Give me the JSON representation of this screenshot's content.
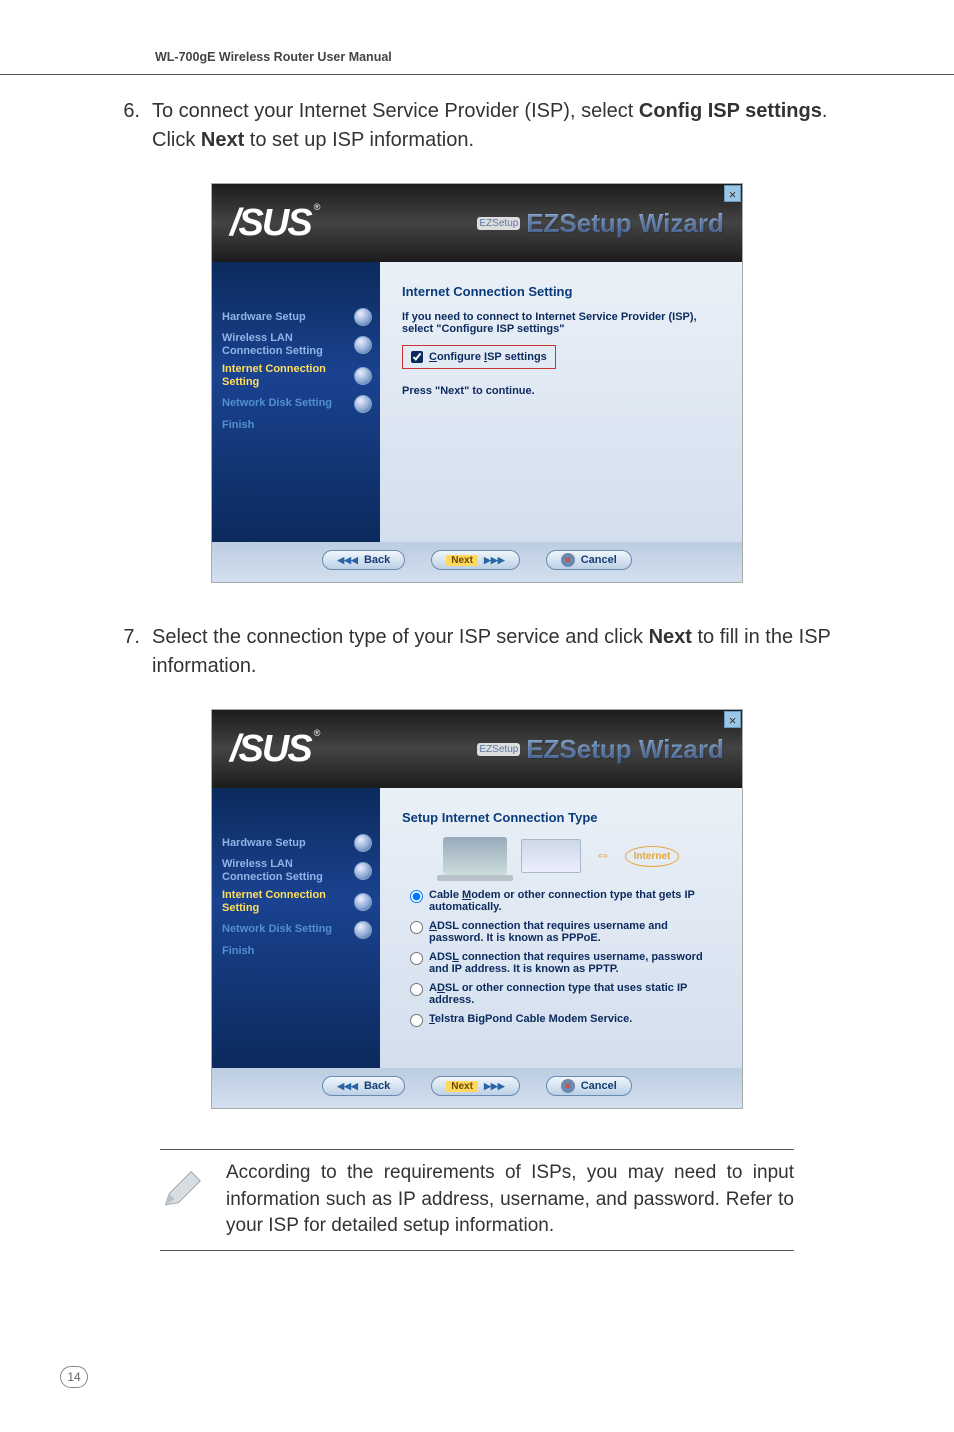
{
  "header": {
    "manual_title": "WL-700gE Wireless Router User Manual"
  },
  "step6": {
    "num": "6.",
    "text_pre": "To connect your Internet Service Provider (ISP), select ",
    "bold1": "Config ISP settings",
    "text_mid": ". Click ",
    "bold2": "Next",
    "text_post": " to set up ISP information."
  },
  "dialog1": {
    "brand": "EZSetup Wizard",
    "brand_tag": "EZSetup",
    "side": [
      {
        "label": "Hardware Setup",
        "state": "done"
      },
      {
        "label": "Wireless LAN Connection Setting",
        "state": "done"
      },
      {
        "label": "Internet Connection Setting",
        "state": "active"
      },
      {
        "label": "Network Disk Setting",
        "state": "pending"
      },
      {
        "label": "Finish",
        "state": "pending"
      }
    ],
    "panel_title": "Internet Connection Setting",
    "intro": "If you need to connect to Internet Service Provider (ISP), select \"Configure ISP settings\"",
    "checkbox_label": "Configure ISP settings",
    "continue": "Press \"Next\" to continue.",
    "buttons": {
      "back": "Back",
      "next": "Next",
      "cancel": "Cancel"
    }
  },
  "step7": {
    "num": "7.",
    "text_pre": "Select the connection type of your ISP service and click ",
    "bold1": "Next",
    "text_post": " to fill in the ISP information."
  },
  "dialog2": {
    "brand": "EZSetup Wizard",
    "brand_tag": "EZSetup",
    "side": [
      {
        "label": "Hardware Setup",
        "state": "done"
      },
      {
        "label": "Wireless LAN Connection Setting",
        "state": "done"
      },
      {
        "label": "Internet Connection Setting",
        "state": "active"
      },
      {
        "label": "Network Disk Setting",
        "state": "pending"
      },
      {
        "label": "Finish",
        "state": "pending"
      }
    ],
    "panel_title": "Setup Internet Connection Type",
    "internet_label": "Internet",
    "options": [
      "Cable Modem or other connection type that gets IP automatically.",
      "ADSL connection that requires username and password. It is known as PPPoE.",
      "ADSL connection that requires username, password and IP address. It is known as PPTP.",
      "ADSL or other connection type that uses static IP address.",
      "Telstra BigPond Cable Modem Service."
    ],
    "buttons": {
      "back": "Back",
      "next": "Next",
      "cancel": "Cancel"
    }
  },
  "note": {
    "text": "According to the requirements of ISPs, you may need to input information such as IP address, username, and password. Refer to your ISP for detailed setup information."
  },
  "page_number": "14"
}
